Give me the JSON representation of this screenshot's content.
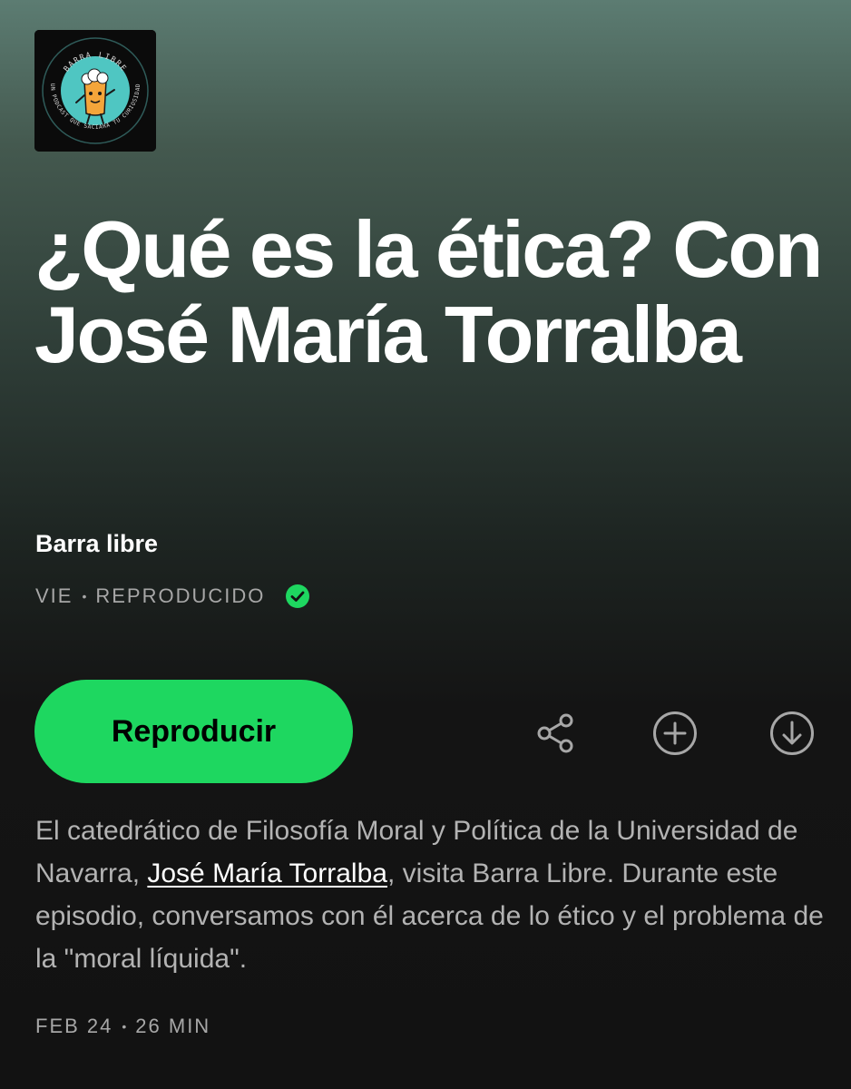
{
  "podcast": {
    "cover_top_text": "BARRA LIBRE",
    "cover_ring_text": "UN PODCAST QUE SACIARÁ TU CURIOSIDAD",
    "show_name": "Barra libre"
  },
  "episode": {
    "title": "¿Qué es la ética? Con José María Torralba",
    "release_day": "VIE",
    "separator": "•",
    "play_status": "REPRODUCIDO",
    "published_date": "FEB 24",
    "duration": "26 MIN"
  },
  "actions": {
    "play_label": "Reproducir",
    "icons": [
      "share-icon",
      "add-icon",
      "download-icon"
    ]
  },
  "description": {
    "text_before_link": "El catedrático de Filosofía Moral y Política de la Universidad de Navarra, ",
    "link_text": "José María Torralba",
    "text_after_link": ", visita Barra Libre. Durante este episodio, conversamos con él acerca de lo ético y el problema de la \"moral líquida\"."
  },
  "colors": {
    "accent": "#1ed760",
    "header_gradient_top": "#5c7c72",
    "background": "#121212",
    "secondary_text": "#a7a7a7",
    "cover_circle": "#4fc6c2"
  }
}
